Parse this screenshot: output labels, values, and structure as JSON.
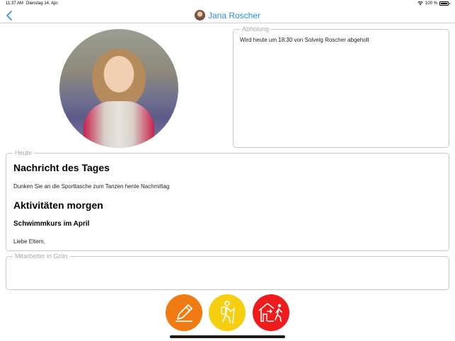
{
  "status_bar": {
    "time": "11:37 AM",
    "date": "Dienstag 14. Apr.",
    "battery": "100 %"
  },
  "nav": {
    "back_icon": "chevron-left-icon",
    "child_name": "Jana Roscher",
    "accent_color": "#2b8ee8"
  },
  "pickup": {
    "legend": "Abholung",
    "text": "Wird heute um 18:30 von Solveig Roscher abgeholt"
  },
  "today": {
    "legend": "Heute",
    "message_heading": "Nachricht des Tages",
    "message_text": "Dunken Sie an die Sporttasche zum Tanzen hente Nachmittag",
    "activities_heading": "Aktivitäten morgen",
    "activity_title": "Schwimmkurs im April",
    "activity_text": "Liebe Eltern,"
  },
  "staff": {
    "legend": "Mitarbeiter in Grün"
  },
  "actions": [
    {
      "icon": "pencil-icon",
      "color": "#f07b12"
    },
    {
      "icon": "hiker-icon",
      "color": "#f5cf10"
    },
    {
      "icon": "leave-house-icon",
      "color": "#ee1c1c"
    }
  ]
}
